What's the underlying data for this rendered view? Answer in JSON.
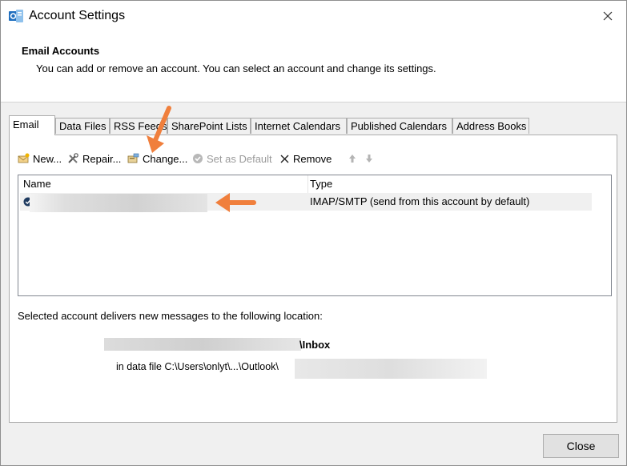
{
  "window": {
    "title": "Account Settings"
  },
  "header": {
    "title": "Email Accounts",
    "description": "You can add or remove an account. You can select an account and change its settings."
  },
  "tabs": [
    {
      "label": "Email",
      "active": true
    },
    {
      "label": "Data Files"
    },
    {
      "label": "RSS Feeds"
    },
    {
      "label": "SharePoint Lists"
    },
    {
      "label": "Internet Calendars"
    },
    {
      "label": "Published Calendars"
    },
    {
      "label": "Address Books"
    }
  ],
  "toolbar": {
    "new_label": "New...",
    "repair_label": "Repair...",
    "change_label": "Change...",
    "set_default_label": "Set as Default",
    "remove_label": "Remove"
  },
  "accounts_list": {
    "columns": [
      "Name",
      "Type"
    ],
    "rows": [
      {
        "name": "",
        "type": "IMAP/SMTP (send from this account by default)"
      }
    ]
  },
  "delivery": {
    "text": "Selected account delivers new messages to the following location:",
    "folder_suffix": "\\Inbox",
    "data_file_prefix": "in data file C:\\Users\\onlyt\\...\\Outlook\\"
  },
  "footer": {
    "close_label": "Close"
  },
  "colors": {
    "annotation_arrow": "#f07f3c",
    "selected_row": "#f0f0f0"
  }
}
